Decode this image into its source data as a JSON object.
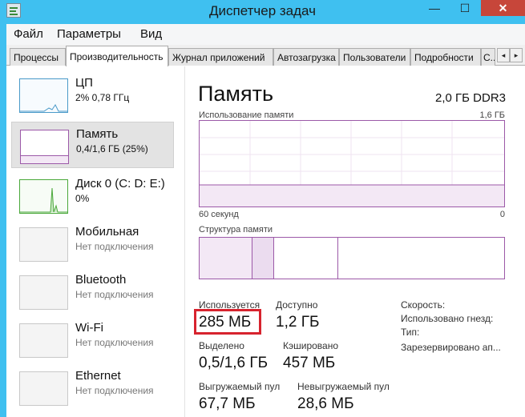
{
  "window": {
    "title": "Диспетчер задач",
    "min_glyph": "—",
    "max_glyph": "☐",
    "close_glyph": "✕"
  },
  "menu": [
    "Файл",
    "Параметры",
    "Вид"
  ],
  "tabs": [
    "Процессы",
    "Производительность",
    "Журнал приложений",
    "Автозагрузка",
    "Пользователи",
    "Подробности",
    "С..."
  ],
  "tab_scroll": {
    "left": "◂",
    "right": "▸"
  },
  "sidebar": [
    {
      "name": "ЦП",
      "sub": "2% 0,78 ГГц"
    },
    {
      "name": "Память",
      "sub": "0,4/1,6 ГБ (25%)"
    },
    {
      "name": "Диск 0 (C: D: E:)",
      "sub": "0%"
    },
    {
      "name": "Мобильная",
      "sub": "Нет подключения"
    },
    {
      "name": "Bluetooth",
      "sub": "Нет подключения"
    },
    {
      "name": "Wi-Fi",
      "sub": "Нет подключения"
    },
    {
      "name": "Ethernet",
      "sub": "Нет подключения"
    }
  ],
  "main": {
    "title": "Память",
    "spec": "2,0 ГБ DDR3",
    "usage_label": "Использование памяти",
    "usage_max": "1,6 ГБ",
    "time_left": "60 секунд",
    "time_right": "0",
    "usage_fraction": 0.25,
    "structure_label": "Структура памяти",
    "stats": {
      "in_use_label": "Используется",
      "in_use": "285 МБ",
      "available_label": "Доступно",
      "available": "1,2 ГБ",
      "committed_label": "Выделено",
      "committed": "0,5/1,6 ГБ",
      "cached_label": "Кэшировано",
      "cached": "457 МБ",
      "paged_label": "Выгружаемый пул",
      "paged": "67,7 МБ",
      "nonpaged_label": "Невыгружаемый пул",
      "nonpaged": "28,6 МБ"
    },
    "right_labels": [
      "Скорость:",
      "Использовано гнезд:",
      "Тип:",
      "Зарезервировано ап..."
    ]
  },
  "colors": {
    "accent_memory": "#9c59a8",
    "accent_cpu": "#4a9ac9",
    "accent_disk": "#4aa83a",
    "highlight": "#d7232e",
    "chrome": "#3fc0f0"
  }
}
